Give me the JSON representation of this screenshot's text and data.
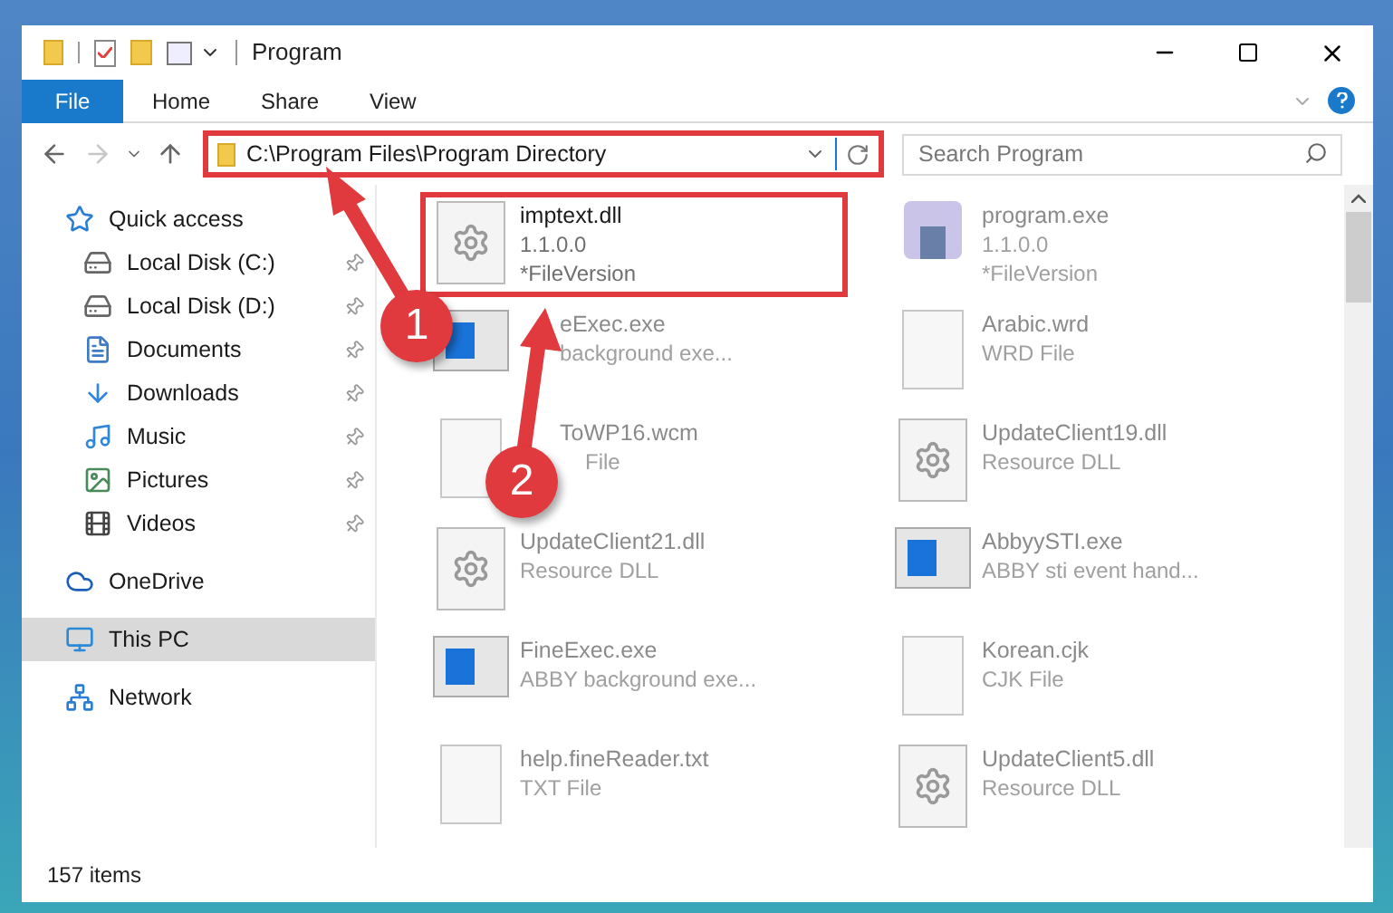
{
  "window": {
    "title": "Program"
  },
  "ribbon_tabs": [
    {
      "label": "File",
      "selected": true
    },
    {
      "label": "Home",
      "selected": false
    },
    {
      "label": "Share",
      "selected": false
    },
    {
      "label": "View",
      "selected": false
    }
  ],
  "nav_buttons": [
    {
      "kind": "back",
      "disabled": false
    },
    {
      "kind": "forward",
      "disabled": true
    },
    {
      "kind": "recent",
      "disabled": false
    },
    {
      "kind": "up",
      "disabled": false
    }
  ],
  "address_bar": {
    "value": "C:\\Program Files\\Program Directory",
    "highlighted": true
  },
  "search": {
    "placeholder": "Search Program"
  },
  "sidebar": {
    "items": [
      {
        "label": "Quick access",
        "kind": "star",
        "selected": false,
        "children": [
          {
            "label": "Local Disk (C:)",
            "kind": "disk",
            "pinned": true,
            "selected": false
          },
          {
            "label": "Local Disk (D:)",
            "kind": "disk",
            "pinned": true,
            "selected": false
          },
          {
            "label": "Documents",
            "kind": "documents",
            "pinned": true,
            "selected": false
          },
          {
            "label": "Downloads",
            "kind": "downloads",
            "pinned": true,
            "selected": false
          },
          {
            "label": "Music",
            "kind": "music",
            "pinned": true,
            "selected": false
          },
          {
            "label": "Pictures",
            "kind": "pictures",
            "pinned": true,
            "selected": false
          },
          {
            "label": "Videos",
            "kind": "videos",
            "pinned": true,
            "selected": false
          }
        ]
      },
      {
        "label": "OneDrive",
        "kind": "cloud",
        "selected": false
      },
      {
        "label": "This PC",
        "kind": "pc",
        "selected": true
      },
      {
        "label": "Network",
        "kind": "network",
        "selected": false
      }
    ]
  },
  "files": [
    {
      "name": "imptext.dll",
      "details": [
        "1.1.0.0",
        "*FileVersion"
      ],
      "kind": "dll",
      "highlighted": true
    },
    {
      "name": "program.exe",
      "details": [
        "1.1.0.0",
        "*FileVersion"
      ],
      "kind": "program",
      "highlighted": false
    },
    {
      "name": "eExec.exe",
      "details": [
        "background exe..."
      ],
      "kind": "exe",
      "highlighted": false
    },
    {
      "name": "Arabic.wrd",
      "details": [
        "WRD File"
      ],
      "kind": "file",
      "highlighted": false
    },
    {
      "name": "ToWP16.wcm",
      "details": [
        "File"
      ],
      "kind": "file",
      "highlighted": false
    },
    {
      "name": "UpdateClient19.dll",
      "details": [
        "Resource DLL"
      ],
      "kind": "dll",
      "highlighted": false
    },
    {
      "name": "UpdateClient21.dll",
      "details": [
        "Resource DLL"
      ],
      "kind": "dll",
      "highlighted": false
    },
    {
      "name": "AbbyySTI.exe",
      "details": [
        "ABBY sti event hand..."
      ],
      "kind": "exe",
      "highlighted": false
    },
    {
      "name": "FineExec.exe",
      "details": [
        "ABBY background exe..."
      ],
      "kind": "exe",
      "highlighted": false
    },
    {
      "name": "Korean.cjk",
      "details": [
        "CJK File"
      ],
      "kind": "file",
      "highlighted": false
    },
    {
      "name": "help.fineReader.txt",
      "details": [
        "TXT File"
      ],
      "kind": "file",
      "highlighted": false
    },
    {
      "name": "UpdateClient5.dll",
      "details": [
        "Resource DLL"
      ],
      "kind": "dll",
      "highlighted": false
    }
  ],
  "annotations": [
    {
      "number": "1"
    },
    {
      "number": "2"
    }
  ],
  "status_bar": {
    "item_count": "157 items"
  }
}
